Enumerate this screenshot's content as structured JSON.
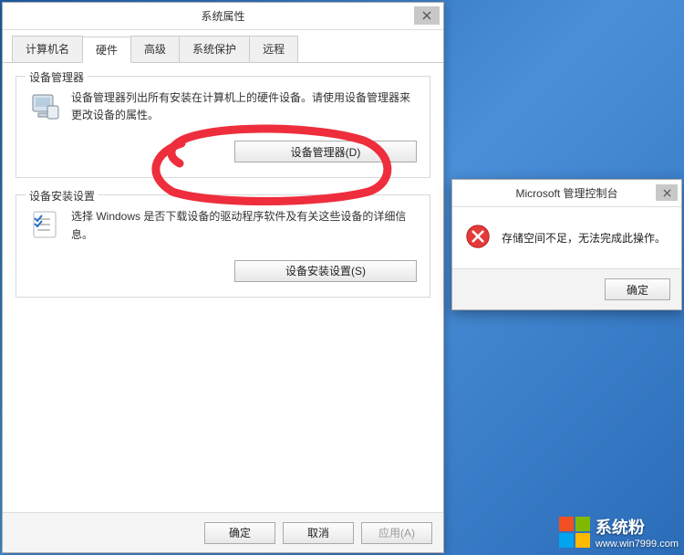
{
  "main_dialog": {
    "title": "系统属性",
    "tabs": [
      {
        "label": "计算机名",
        "active": false
      },
      {
        "label": "硬件",
        "active": true
      },
      {
        "label": "高级",
        "active": false
      },
      {
        "label": "系统保护",
        "active": false
      },
      {
        "label": "远程",
        "active": false
      }
    ],
    "group1": {
      "legend": "设备管理器",
      "desc": "设备管理器列出所有安装在计算机上的硬件设备。请使用设备管理器来更改设备的属性。",
      "button": "设备管理器(D)"
    },
    "group2": {
      "legend": "设备安装设置",
      "desc": "选择 Windows 是否下载设备的驱动程序软件及有关这些设备的详细信息。",
      "button": "设备安装设置(S)"
    },
    "footer": {
      "ok": "确定",
      "cancel": "取消",
      "apply": "应用(A)"
    }
  },
  "msg_dialog": {
    "title": "Microsoft 管理控制台",
    "message": "存储空间不足，无法完成此操作。",
    "ok": "确定"
  },
  "watermark": {
    "brand": "系统粉",
    "url": "www.win7999.com"
  },
  "annotation_color": "#ee2e3c"
}
